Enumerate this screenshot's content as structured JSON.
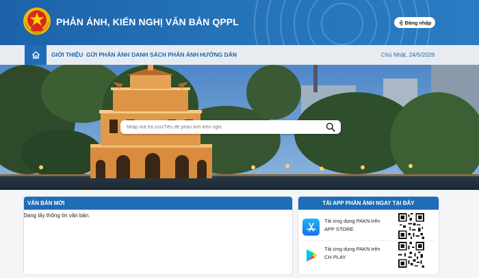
{
  "header": {
    "title": "PHẢN ÁNH, KIẾN NGHỊ VĂN BẢN QPPL",
    "login_label": "Đăng nhập"
  },
  "nav": {
    "items": [
      "GIỚI THIỆU",
      "GỬI PHẢN ÁNH",
      "DANH SÁCH PHẢN ÁNH",
      "HƯỚNG DẪN"
    ],
    "date": "Chủ Nhật, 24/5/2026"
  },
  "search": {
    "placeholder": "Nhập mã tra cứu/Tiêu đề phản ánh kiến nghị"
  },
  "new_docs": {
    "title": "VĂN BẢN MỚI",
    "loading": "Đang lấy thông tin văn bản."
  },
  "apps": {
    "title": "TẢI APP PHẢN ÁNH NGAY TẠI ĐÂY",
    "appstore": {
      "line1": "Tải ứng dụng PAKN trên",
      "line2": "APP STORE",
      "icon": "app-store-icon"
    },
    "chplay": {
      "line1": "Tải ứng dụng PAKN trên",
      "line2": "CH PLAY",
      "icon": "google-play-icon"
    }
  },
  "colors": {
    "primary": "#1f6db6",
    "header": "#2472b8",
    "nav_bg": "#e8ecf1",
    "accent_red": "#d52b1e",
    "gold": "#f5c518"
  }
}
